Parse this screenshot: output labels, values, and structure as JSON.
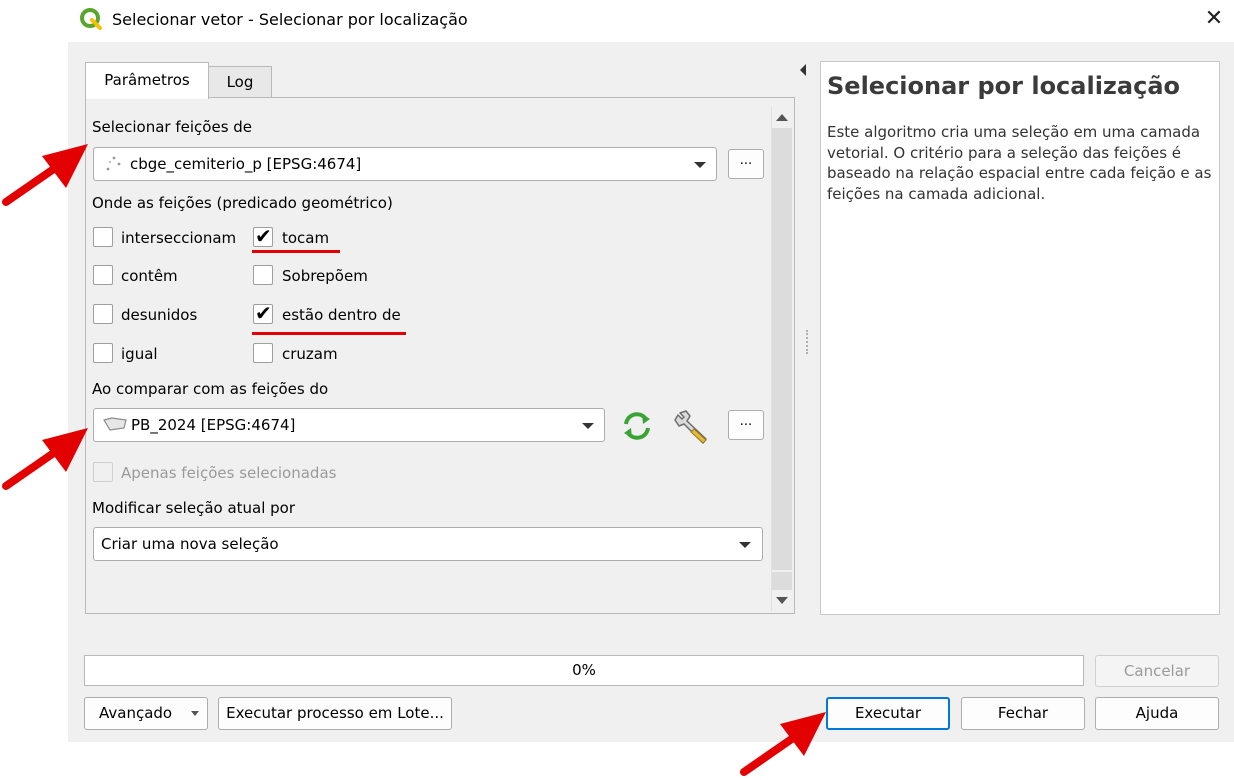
{
  "window": {
    "title": "Selecionar vetor - Selecionar por localização",
    "close_glyph": "✕",
    "app_icon": "qgis-logo-icon"
  },
  "tabs": [
    {
      "label": "Parâmetros",
      "active": true
    },
    {
      "label": "Log",
      "active": false
    }
  ],
  "params": {
    "select_from_label": "Selecionar feições de",
    "select_from_value": "cbge_cemiterio_p [EPSG:4674]",
    "predicate_label": "Onde as feições (predicado geométrico)",
    "predicates": [
      {
        "label": "interseccionam",
        "checked": false
      },
      {
        "label": "tocam",
        "checked": true
      },
      {
        "label": "contêm",
        "checked": false
      },
      {
        "label": "Sobrepõem",
        "checked": false
      },
      {
        "label": "desunidos",
        "checked": false
      },
      {
        "label": "estão dentro de",
        "checked": true
      },
      {
        "label": "igual",
        "checked": false
      },
      {
        "label": "cruzam",
        "checked": false
      }
    ],
    "compare_label": "Ao comparar com as feições do",
    "compare_value": "PB_2024 [EPSG:4674]",
    "selected_only_label": "Apenas feições selecionadas",
    "modify_label": "Modificar seleção atual por",
    "modify_value": "Criar uma nova seleção",
    "dots": "..."
  },
  "help": {
    "title": "Selecionar por localização",
    "body": "Este algoritmo cria uma seleção em uma camada vetorial. O critério para a seleção das feições é baseado na relação espacial entre cada feição e as feições na camada adicional."
  },
  "progress": {
    "text": "0%",
    "value": 0
  },
  "buttons": {
    "cancel": "Cancelar",
    "advanced": "Avançado",
    "batch": "Executar processo em Lote...",
    "run": "Executar",
    "close": "Fechar",
    "help": "Ajuda"
  },
  "colors": {
    "annotation_red": "#e30000",
    "refresh_green": "#3aa335",
    "primary_border": "#0078d7"
  }
}
